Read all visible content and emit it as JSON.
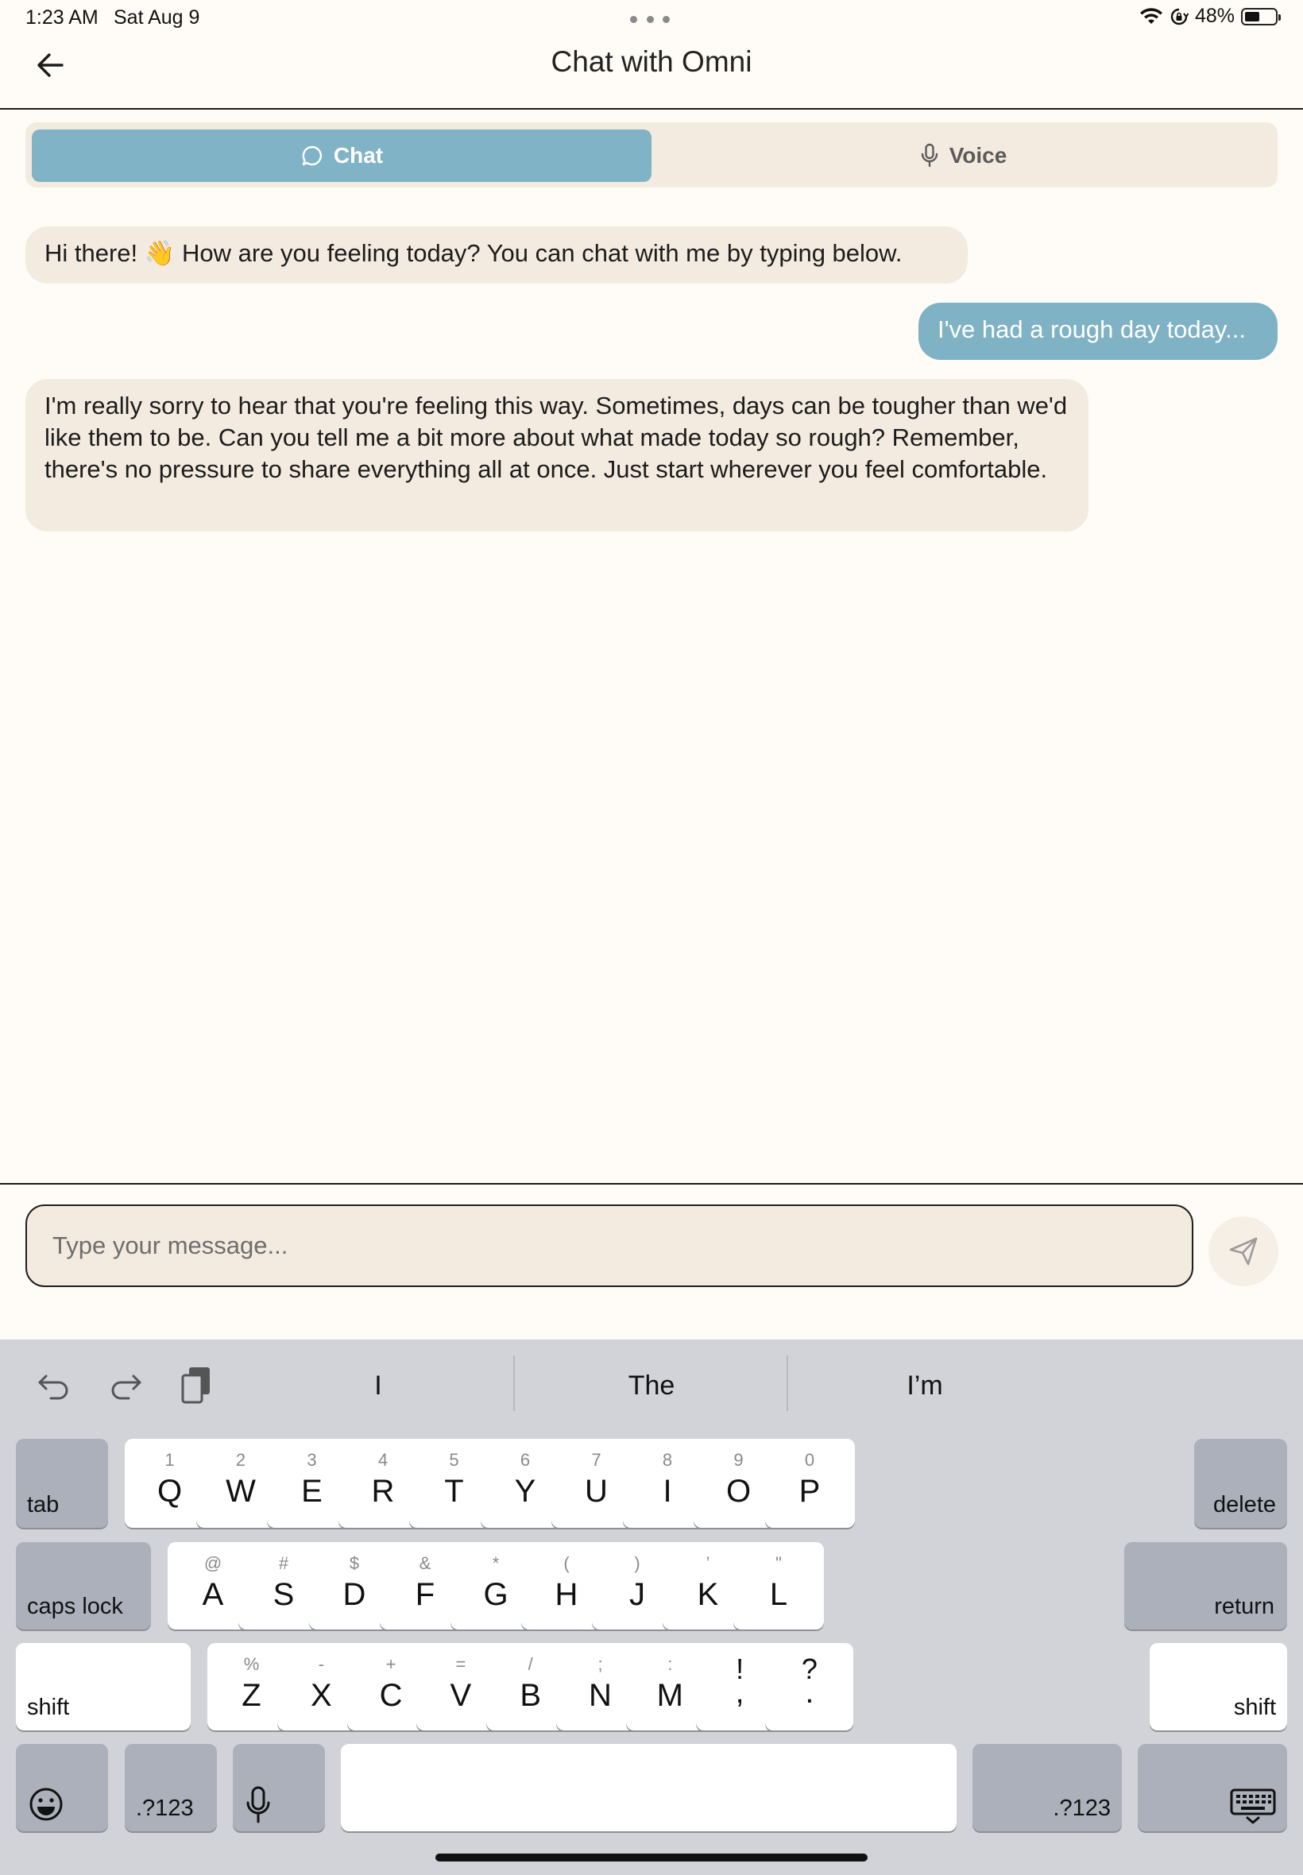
{
  "status_bar": {
    "time": "1:23 AM",
    "date": "Sat Aug 9",
    "battery_text": "48%",
    "battery_level": 0.48,
    "icons": [
      "wifi-icon",
      "orientation-lock-icon",
      "battery-icon"
    ]
  },
  "header": {
    "title": "Chat with Omni",
    "back_icon": "arrow-left-icon"
  },
  "tabs": [
    {
      "label": "Chat",
      "icon": "chat-bubble-icon",
      "selected": true
    },
    {
      "label": "Voice",
      "icon": "microphone-icon",
      "selected": false
    }
  ],
  "messages": [
    {
      "sender": "bot",
      "text": "Hi there! 👋 How are you feeling today? You can chat with me by typing below."
    },
    {
      "sender": "user",
      "text": "I've had a rough day today..."
    },
    {
      "sender": "bot",
      "text": "I'm really sorry to hear that you're feeling this way. Sometimes, days can be tougher than we'd like them to be. Can you tell me a bit more about what made today so rough? Remember, there's no pressure to share everything all at once. Just start wherever you feel comfortable."
    }
  ],
  "composer": {
    "placeholder": "Type your message...",
    "send_icon": "send-icon"
  },
  "keyboard": {
    "suggestions": [
      "I",
      "The",
      "I’m"
    ],
    "tools": [
      "undo-icon",
      "redo-icon",
      "clipboard-icon"
    ],
    "row1": {
      "tab": "tab",
      "keys": [
        {
          "main": "Q",
          "sub": "1"
        },
        {
          "main": "W",
          "sub": "2"
        },
        {
          "main": "E",
          "sub": "3"
        },
        {
          "main": "R",
          "sub": "4"
        },
        {
          "main": "T",
          "sub": "5"
        },
        {
          "main": "Y",
          "sub": "6"
        },
        {
          "main": "U",
          "sub": "7"
        },
        {
          "main": "I",
          "sub": "8"
        },
        {
          "main": "O",
          "sub": "9"
        },
        {
          "main": "P",
          "sub": "0"
        }
      ],
      "delete": "delete"
    },
    "row2": {
      "caps": "caps lock",
      "keys": [
        {
          "main": "A",
          "sub": "@"
        },
        {
          "main": "S",
          "sub": "#"
        },
        {
          "main": "D",
          "sub": "$"
        },
        {
          "main": "F",
          "sub": "&"
        },
        {
          "main": "G",
          "sub": "*"
        },
        {
          "main": "H",
          "sub": "("
        },
        {
          "main": "J",
          "sub": ")"
        },
        {
          "main": "K",
          "sub": "’"
        },
        {
          "main": "L",
          "sub": "\""
        }
      ],
      "return": "return"
    },
    "row3": {
      "shift_left": "shift",
      "keys": [
        {
          "main": "Z",
          "sub": "%"
        },
        {
          "main": "X",
          "sub": "-"
        },
        {
          "main": "C",
          "sub": "+"
        },
        {
          "main": "V",
          "sub": "="
        },
        {
          "main": "B",
          "sub": "/"
        },
        {
          "main": "N",
          "sub": ";"
        },
        {
          "main": "M",
          "sub": ":"
        },
        {
          "main": ",",
          "sub": "!"
        },
        {
          "main": ".",
          "sub": "?"
        }
      ],
      "shift_right": "shift"
    },
    "row4": {
      "emoji_icon": "emoji-icon",
      "numbers_left": ".?123",
      "mic_icon": "microphone-icon",
      "space": "",
      "numbers_right": ".?123",
      "dismiss_icon": "keyboard-dismiss-icon"
    }
  },
  "colors": {
    "background": "#fffcf7",
    "accent": "#80b3c5",
    "bubble_bot": "#f3ebdf",
    "keyboard_bg": "#d1d3d9"
  }
}
